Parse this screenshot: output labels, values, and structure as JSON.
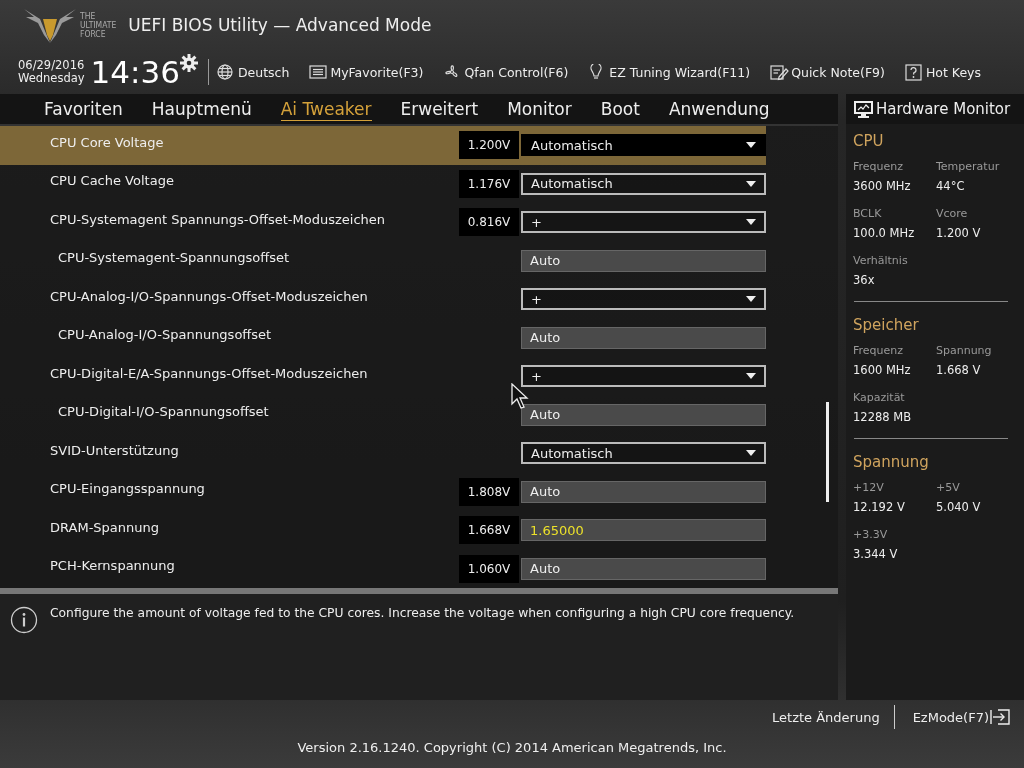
{
  "header": {
    "logo_text": [
      "THE",
      "ULTIMATE",
      "FORCE"
    ],
    "title": "UEFI BIOS Utility — Advanced Mode"
  },
  "toolbar": {
    "date": "06/29/2016",
    "weekday": "Wednesday",
    "time": "14:36",
    "items": [
      {
        "kind": "globe",
        "label": "Deutsch"
      },
      {
        "kind": "favorite",
        "label": "MyFavorite(F3)"
      },
      {
        "kind": "fan",
        "label": "Qfan Control(F6)"
      },
      {
        "kind": "bulb",
        "label": "EZ Tuning Wizard(F11)"
      },
      {
        "kind": "note",
        "label": "Quick Note(F9)"
      },
      {
        "kind": "help",
        "label": "Hot Keys"
      }
    ]
  },
  "tabs": [
    {
      "label": "Favoriten",
      "selected": false
    },
    {
      "label": "Hauptmenü",
      "selected": false
    },
    {
      "label": "Ai Tweaker",
      "selected": true
    },
    {
      "label": "Erweitert",
      "selected": false
    },
    {
      "label": "Monitor",
      "selected": false
    },
    {
      "label": "Boot",
      "selected": false
    },
    {
      "label": "Anwendung",
      "selected": false
    }
  ],
  "settings": [
    {
      "label": "CPU Core Voltage",
      "reading": "1.200V",
      "kind": "dropdown",
      "value": "Automatisch",
      "sub": false,
      "selected": true
    },
    {
      "label": "CPU Cache Voltage",
      "reading": "1.176V",
      "kind": "dropdown",
      "value": "Automatisch",
      "sub": false,
      "selected": false
    },
    {
      "label": "CPU-Systemagent Spannungs-Offset-Moduszeichen",
      "reading": "0.816V",
      "kind": "dropdown",
      "value": "+",
      "sub": false,
      "selected": false
    },
    {
      "label": "CPU-Systemagent-Spannungsoffset",
      "kind": "field",
      "value": "Auto",
      "sub": true,
      "selected": false
    },
    {
      "label": "CPU-Analog-I/O-Spannungs-Offset-Moduszeichen",
      "kind": "dropdown",
      "value": "+",
      "sub": false,
      "selected": false
    },
    {
      "label": "CPU-Analog-I/O-Spannungsoffset",
      "kind": "field",
      "value": "Auto",
      "sub": true,
      "selected": false
    },
    {
      "label": "CPU-Digital-E/A-Spannungs-Offset-Moduszeichen",
      "kind": "dropdown",
      "value": "+",
      "sub": false,
      "selected": false
    },
    {
      "label": "CPU-Digital-I/O-Spannungsoffset",
      "kind": "field",
      "value": "Auto",
      "sub": true,
      "selected": false
    },
    {
      "label": "SVID-Unterstützung",
      "kind": "dropdown",
      "value": "Automatisch",
      "sub": false,
      "selected": false
    },
    {
      "label": "CPU-Eingangsspannung",
      "reading": "1.808V",
      "kind": "field",
      "value": "Auto",
      "sub": false,
      "selected": false
    },
    {
      "label": "DRAM-Spannung",
      "reading": "1.668V",
      "kind": "field",
      "value": "1.65000",
      "modified": true,
      "sub": false,
      "selected": false
    },
    {
      "label": "PCH-Kernspannung",
      "reading": "1.060V",
      "kind": "field",
      "value": "Auto",
      "sub": false,
      "selected": false
    }
  ],
  "info": "Configure the amount of voltage fed to the CPU cores. Increase the voltage when configuring a high CPU core frequency.",
  "hardware_monitor": {
    "title": "Hardware Monitor",
    "sections": [
      {
        "title": "CPU",
        "items": [
          {
            "label": "Frequenz",
            "value": "3600 MHz"
          },
          {
            "label": "Temperatur",
            "value": "44°C"
          },
          {
            "label": "BCLK",
            "value": "100.0 MHz"
          },
          {
            "label": "Vcore",
            "value": "1.200 V"
          },
          {
            "label": "Verhältnis",
            "value": "36x"
          }
        ]
      },
      {
        "title": "Speicher",
        "items": [
          {
            "label": "Frequenz",
            "value": "1600 MHz"
          },
          {
            "label": "Spannung",
            "value": "1.668 V"
          },
          {
            "label": "Kapazität",
            "value": "12288 MB"
          }
        ]
      },
      {
        "title": "Spannung",
        "items": [
          {
            "label": "+12V",
            "value": "12.192 V"
          },
          {
            "label": "+5V",
            "value": "5.040 V"
          },
          {
            "label": "+3.3V",
            "value": "3.344 V"
          }
        ]
      }
    ]
  },
  "footer": {
    "last_change": "Letzte Änderung",
    "ez_mode": "EzMode(F7)",
    "version": "Version 2.16.1240. Copyright (C) 2014 American Megatrends, Inc."
  }
}
